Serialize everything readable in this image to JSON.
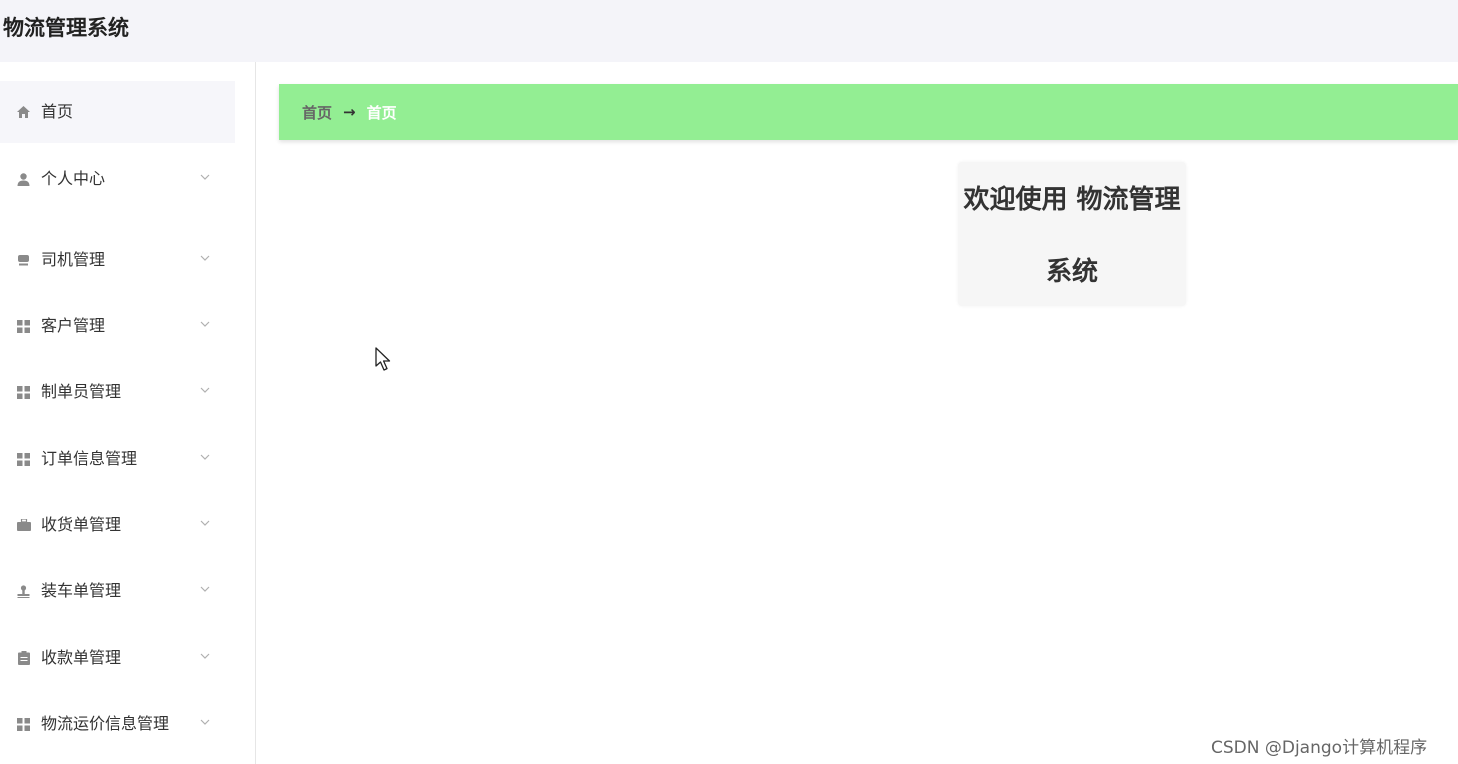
{
  "app": {
    "title": "物流管理系统"
  },
  "sidebar": {
    "items": [
      {
        "label": "首页",
        "icon": "home-icon",
        "active": true,
        "has_chevron": false
      },
      {
        "label": "个人中心",
        "icon": "user-icon",
        "has_chevron": true
      },
      {
        "label": "司机管理",
        "icon": "car-icon",
        "has_chevron": true
      },
      {
        "label": "客户管理",
        "icon": "grid-icon",
        "has_chevron": true
      },
      {
        "label": "制单员管理",
        "icon": "grid-icon",
        "has_chevron": true
      },
      {
        "label": "订单信息管理",
        "icon": "grid-icon",
        "has_chevron": true
      },
      {
        "label": "收货单管理",
        "icon": "briefcase-icon",
        "has_chevron": true
      },
      {
        "label": "装车单管理",
        "icon": "stamp-icon",
        "has_chevron": true
      },
      {
        "label": "收款单管理",
        "icon": "clipboard-icon",
        "has_chevron": true
      },
      {
        "label": "物流运价信息管理",
        "icon": "grid-icon",
        "has_chevron": true
      }
    ]
  },
  "breadcrumb": {
    "parent": "首页",
    "separator": "→",
    "current": "首页"
  },
  "welcome": {
    "line1": "欢迎使用 物流管理",
    "line2": "系统"
  },
  "watermark": "CSDN @Django计算机程序",
  "colors": {
    "breadcrumb_bg": "#93ee93",
    "header_bg": "#f4f4f9",
    "icon_color": "#8a8a8a"
  }
}
